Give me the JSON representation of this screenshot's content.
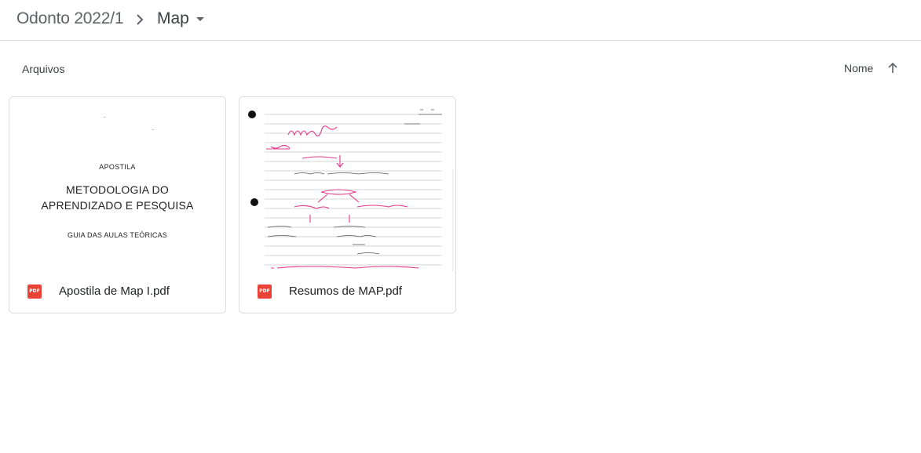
{
  "breadcrumb": {
    "root": "Odonto 2022/1",
    "current": "Map"
  },
  "list": {
    "section_label": "Arquivos",
    "sort_label": "Nome"
  },
  "files": [
    {
      "name": "Apostila de Map I.pdf",
      "type_badge": "PDF",
      "preview": {
        "line1": "APOSTILA",
        "title_line1": "METODOLOGIA DO",
        "title_line2": "APRENDIZADO E PESQUISA",
        "subtitle": "GUIA DAS AULAS TEÓRICAS"
      }
    },
    {
      "name": "Resumos de MAP.pdf",
      "type_badge": "PDF"
    }
  ],
  "colors": {
    "pdf_red": "#ea4335",
    "handwriting_pink": "#e0388a",
    "divider": "#dadce0"
  },
  "icons": {
    "separator": "chevron-right-icon",
    "dropdown": "caret-down-icon",
    "sort": "arrow-up-icon",
    "file_type": "pdf-icon"
  }
}
